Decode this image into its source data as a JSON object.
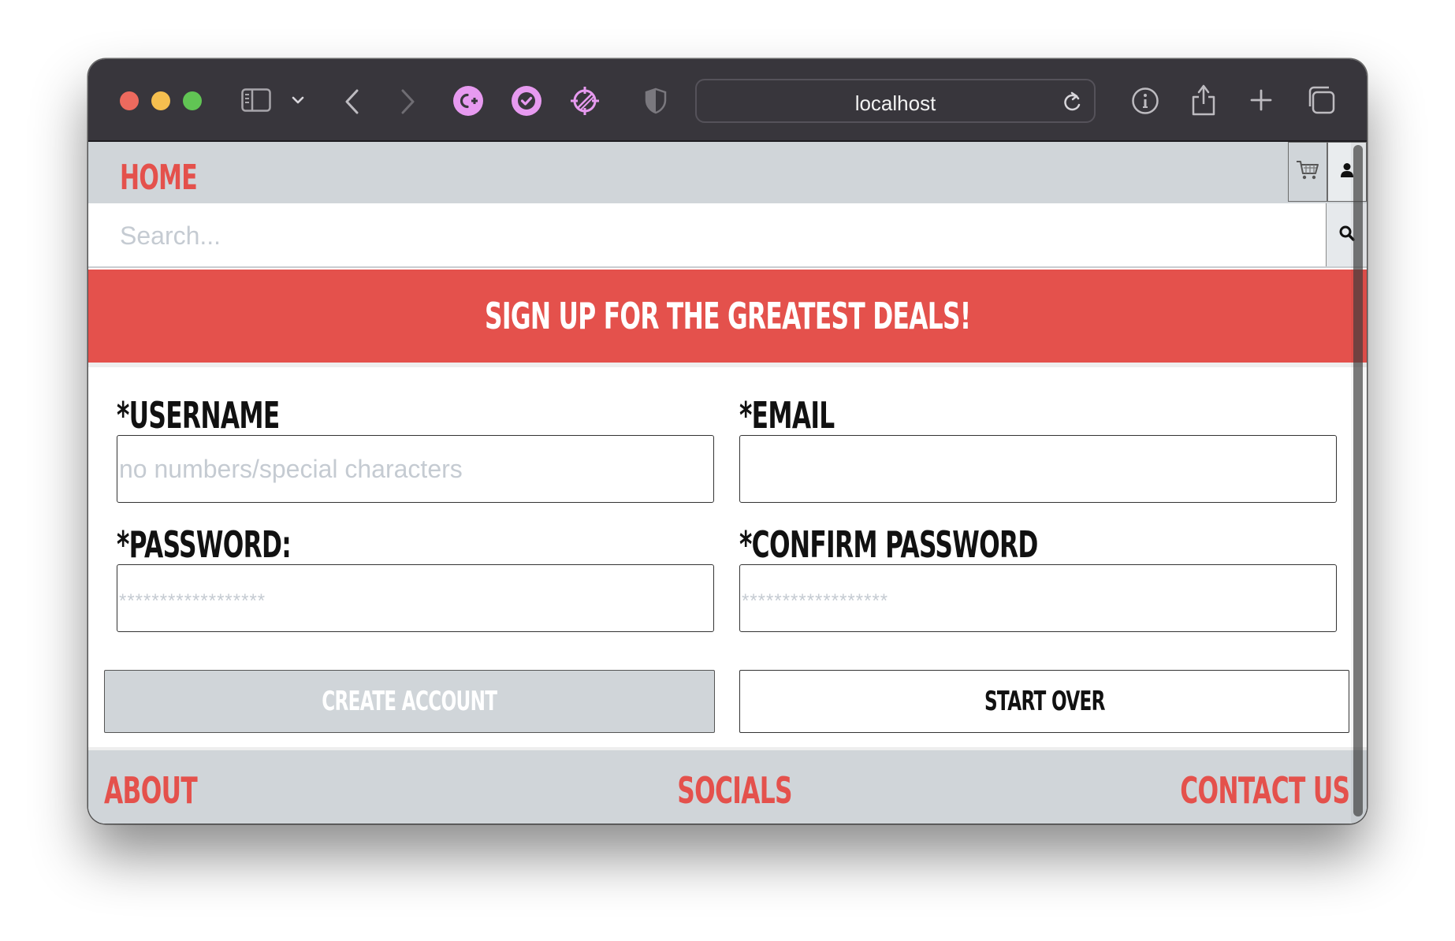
{
  "browser": {
    "address": "localhost",
    "icons": {
      "sidebar": "sidebar-icon",
      "tab_menu": "chevron-down-icon",
      "back": "chevron-left-icon",
      "forward": "chevron-right-icon",
      "extensions": [
        "c-plus-extension-icon",
        "check-extension-icon",
        "target-extension-icon"
      ],
      "privacy": "shield-icon",
      "reload": "reload-icon",
      "info": "info-icon",
      "share": "share-icon",
      "new_tab": "plus-icon",
      "tab_overview": "tabs-overview-icon"
    },
    "colors": {
      "chrome_bg": "#38363c",
      "extension_accent": "#e79af0"
    }
  },
  "nav": {
    "home": "HOME",
    "cart_icon": "cart-icon",
    "user_icon": "user-icon"
  },
  "search": {
    "placeholder": "Search...",
    "value": "",
    "button_icon": "search-icon"
  },
  "banner": {
    "text": "SIGN UP FOR THE GREATEST DEALS!"
  },
  "form": {
    "username": {
      "label": "*USERNAME",
      "placeholder": "no numbers/special characters",
      "value": ""
    },
    "email": {
      "label": "*EMAIL",
      "placeholder": "",
      "value": ""
    },
    "password": {
      "label": "*PASSWORD:",
      "placeholder": "******************",
      "value": ""
    },
    "confirm_password": {
      "label": "*CONFIRM PASSWORD",
      "placeholder": "******************",
      "value": ""
    },
    "create_button": "CREATE ACCOUNT",
    "start_over_button": "START OVER"
  },
  "footer": {
    "about": "ABOUT",
    "socials": "SOCIALS",
    "contact": "CONTACT US"
  },
  "colors": {
    "accent": "#e4514c",
    "nav_bg": "#d0d5d9",
    "disabled_button": "#d0d5d9"
  }
}
